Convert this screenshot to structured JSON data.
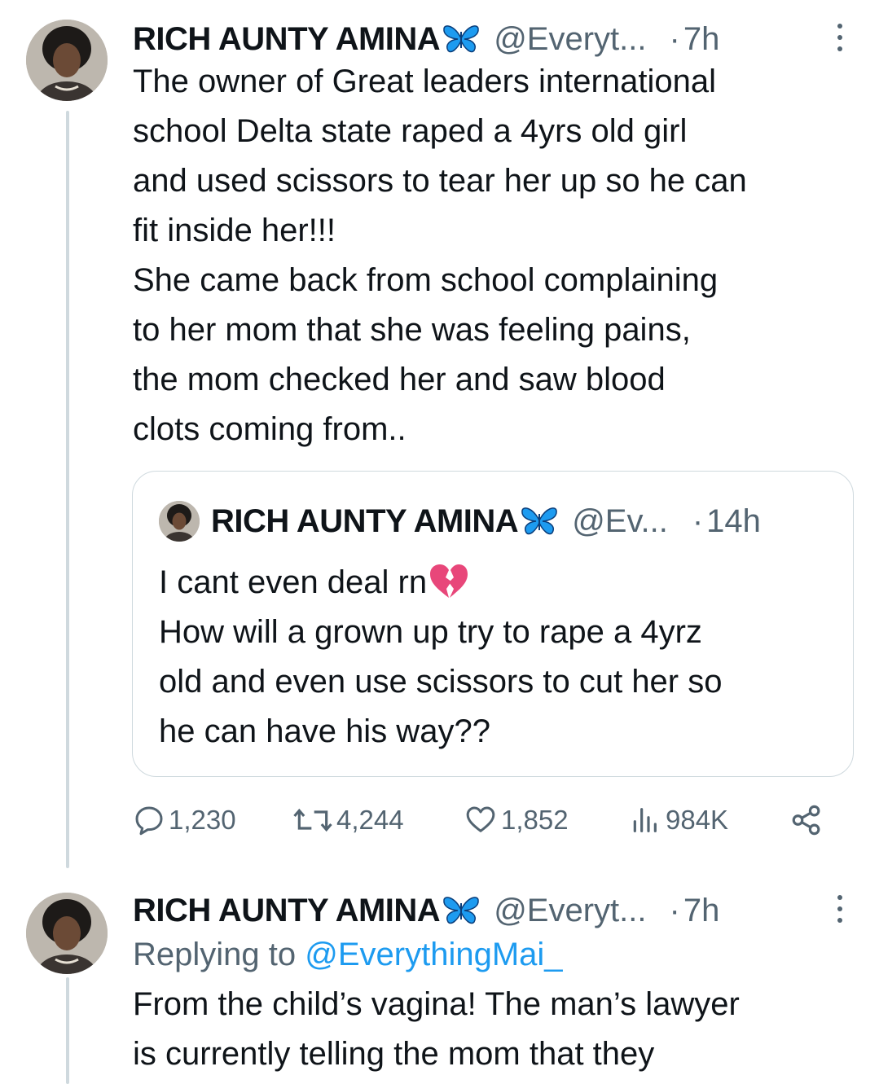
{
  "tweet_main": {
    "display_name": "RICH AUNTY AMINA",
    "badge_icon": "butterfly-icon",
    "handle": "@Everyt...",
    "time": "7h",
    "text": "The owner of Great leaders international\nschool Delta state raped a 4yrs old girl\nand used scissors to tear her up so he can\nfit inside her!!!\n  She came back from school complaining\nto her mom that she was feeling pains,\nthe mom checked her and saw blood\nclots coming from..",
    "quote": {
      "display_name": "RICH AUNTY AMINA",
      "handle": "@Ev...",
      "time": "14h",
      "text_line1": "I cant even deal rn",
      "emoji_icon": "broken-heart-icon",
      "text_rest": "How will a grown up try to rape a 4yrz\nold and even use scissors to cut her so\nhe can have his way??"
    },
    "actions": {
      "replies": "1,230",
      "reposts": "4,244",
      "likes": "1,852",
      "views": "984K"
    }
  },
  "tweet_reply": {
    "display_name": "RICH AUNTY AMINA",
    "handle": "@Everyt...",
    "time": "7h",
    "replying_prefix": "Replying to ",
    "replying_to": "@EverythingMai_",
    "text": "From the child’s vagina! The man’s lawyer\nis currently telling the mom that they"
  },
  "colors": {
    "text_primary": "#0f1419",
    "text_secondary": "#536471",
    "accent_link": "#1d9bf0",
    "border": "#cfd9de"
  }
}
